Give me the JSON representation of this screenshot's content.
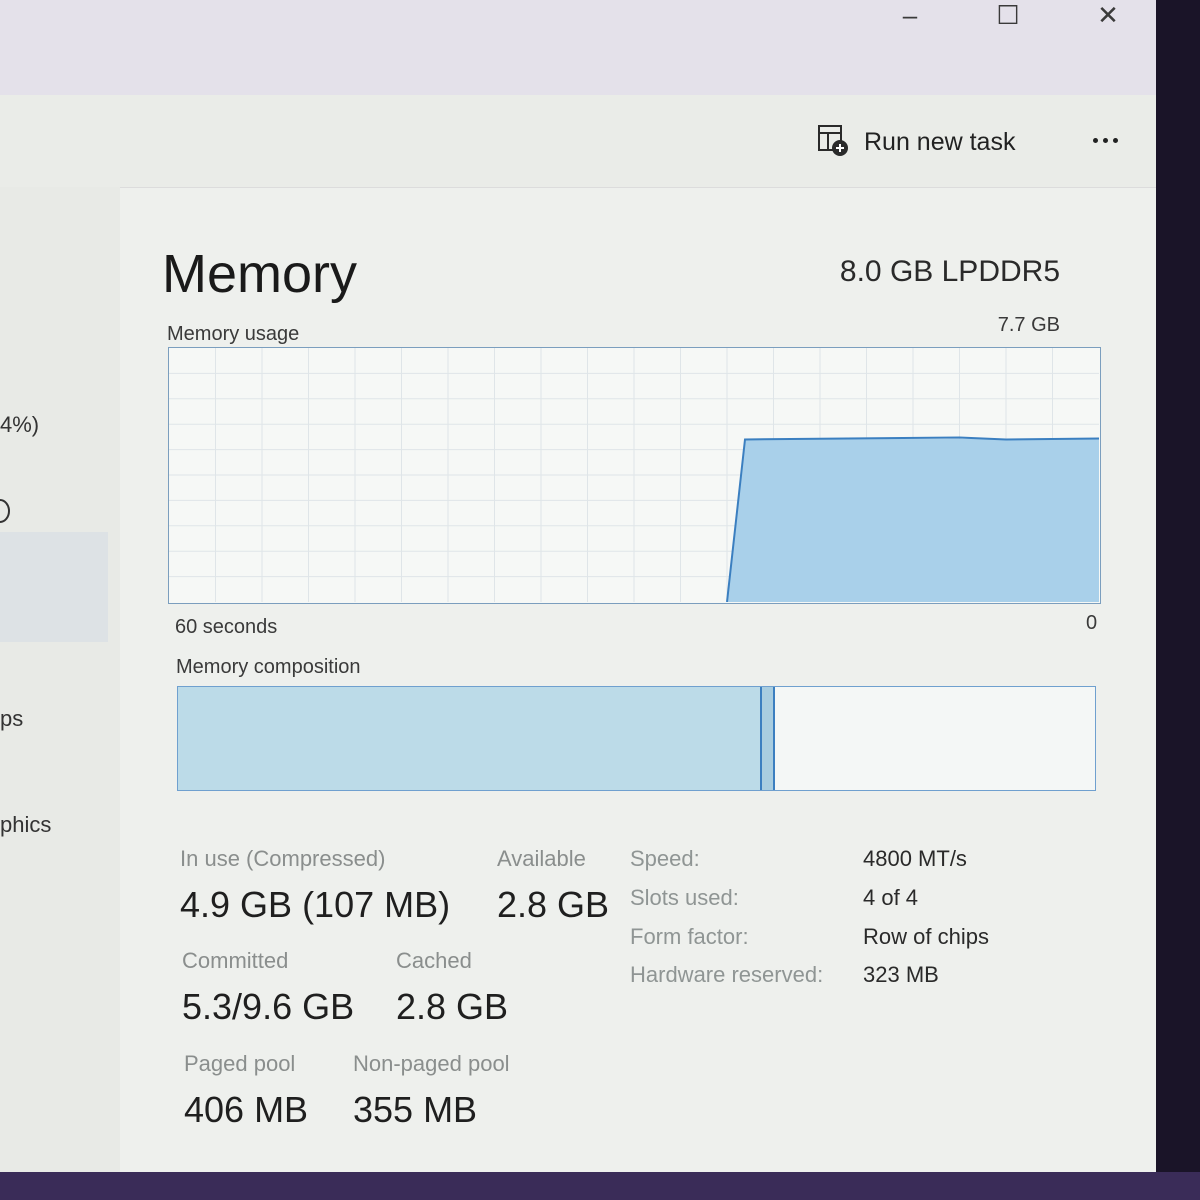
{
  "window": {
    "controls": {
      "minimize": "–",
      "maximize": "☐",
      "close": "✕"
    }
  },
  "toolbar": {
    "run_new_task": "Run new task",
    "run_new_task_icon": "run-task-icon",
    "more_icon": "ellipsis-icon"
  },
  "sidebar": {
    "fragments": [
      "4%)",
      "ps",
      "phics"
    ]
  },
  "memory": {
    "title": "Memory",
    "type": "8.0 GB LPDDR5",
    "usage_label": "Memory usage",
    "max_label": "7.7 GB",
    "time_label": "60 seconds",
    "zero_label": "0",
    "composition_label": "Memory composition",
    "usage_level_fraction": 0.64,
    "usage_starts_at_fraction": 0.6,
    "composition_in_use_fraction": 0.635,
    "composition_modified_fraction": 0.012,
    "accent_color": "#3b7fc0",
    "fill_color": "#a9d0ea"
  },
  "stats": {
    "in_use_label": "In use (Compressed)",
    "in_use_value": "4.9 GB (107 MB)",
    "available_label": "Available",
    "available_value": "2.8 GB",
    "committed_label": "Committed",
    "committed_value": "5.3/9.6 GB",
    "cached_label": "Cached",
    "cached_value": "2.8 GB",
    "paged_pool_label": "Paged pool",
    "paged_pool_value": "406 MB",
    "nonpaged_pool_label": "Non-paged pool",
    "nonpaged_pool_value": "355 MB"
  },
  "specs": {
    "speed_label": "Speed:",
    "speed_value": "4800 MT/s",
    "slots_label": "Slots used:",
    "slots_value": "4 of 4",
    "form_label": "Form factor:",
    "form_value": "Row of chips",
    "hw_label": "Hardware reserved:",
    "hw_value": "323 MB"
  }
}
